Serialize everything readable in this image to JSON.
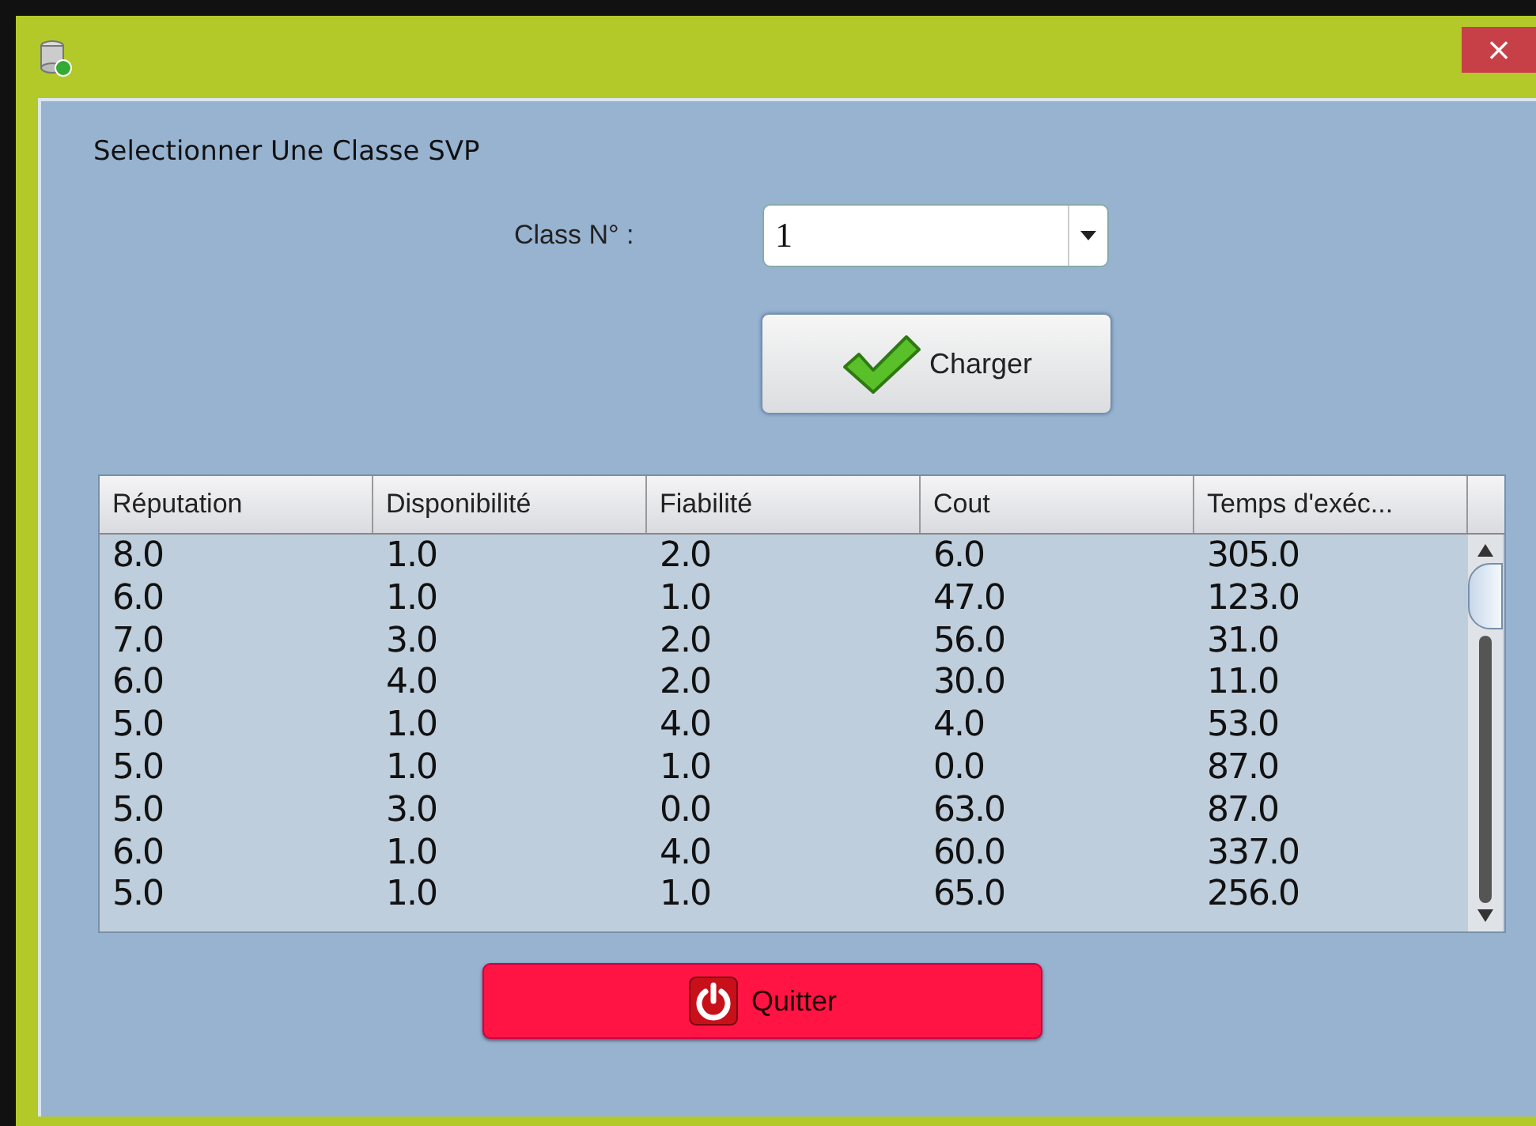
{
  "window": {
    "close": "×"
  },
  "instruction": "Selectionner Une Classe SVP",
  "class_select": {
    "label": "Class N°  :",
    "value": "1"
  },
  "load_button": "Charger",
  "table": {
    "columns": [
      "Réputation",
      "Disponibilité",
      "Fiabilité",
      "Cout",
      "Temps d'exéc..."
    ],
    "rows": [
      [
        "8.0",
        "1.0",
        "2.0",
        "6.0",
        "305.0"
      ],
      [
        "6.0",
        "1.0",
        "1.0",
        "47.0",
        "123.0"
      ],
      [
        "7.0",
        "3.0",
        "2.0",
        "56.0",
        "31.0"
      ],
      [
        "6.0",
        "4.0",
        "2.0",
        "30.0",
        "11.0"
      ],
      [
        "5.0",
        "1.0",
        "4.0",
        "4.0",
        "53.0"
      ],
      [
        "5.0",
        "1.0",
        "1.0",
        "0.0",
        "87.0"
      ],
      [
        "5.0",
        "3.0",
        "0.0",
        "63.0",
        "87.0"
      ],
      [
        "6.0",
        "1.0",
        "4.0",
        "60.0",
        "337.0"
      ],
      [
        "5.0",
        "1.0",
        "1.0",
        "65.0",
        "256.0"
      ]
    ]
  },
  "quit_button": "Quitter"
}
